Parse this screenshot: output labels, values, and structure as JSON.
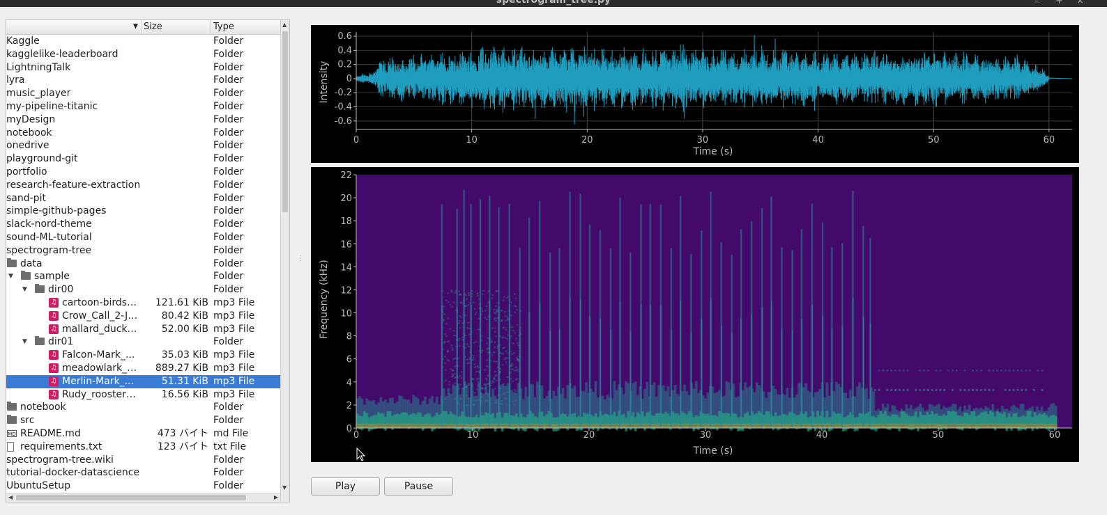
{
  "window": {
    "title": "spectrogram_tree.py"
  },
  "tree": {
    "columns": {
      "name": "",
      "size": "Size",
      "type": "Type"
    },
    "rows": [
      {
        "name": "Kaggle",
        "size": "",
        "type": "Folder",
        "depth": 0,
        "icon": "none"
      },
      {
        "name": "kagglelike-leaderboard",
        "size": "",
        "type": "Folder",
        "depth": 0,
        "icon": "none"
      },
      {
        "name": "LightningTalk",
        "size": "",
        "type": "Folder",
        "depth": 0,
        "icon": "none"
      },
      {
        "name": "lyra",
        "size": "",
        "type": "Folder",
        "depth": 0,
        "icon": "none"
      },
      {
        "name": "music_player",
        "size": "",
        "type": "Folder",
        "depth": 0,
        "icon": "none"
      },
      {
        "name": "my-pipeline-titanic",
        "size": "",
        "type": "Folder",
        "depth": 0,
        "icon": "none"
      },
      {
        "name": "myDesign",
        "size": "",
        "type": "Folder",
        "depth": 0,
        "icon": "none"
      },
      {
        "name": "notebook",
        "size": "",
        "type": "Folder",
        "depth": 0,
        "icon": "none"
      },
      {
        "name": "onedrive",
        "size": "",
        "type": "Folder",
        "depth": 0,
        "icon": "none"
      },
      {
        "name": "playground-git",
        "size": "",
        "type": "Folder",
        "depth": 0,
        "icon": "none"
      },
      {
        "name": "portfolio",
        "size": "",
        "type": "Folder",
        "depth": 0,
        "icon": "none"
      },
      {
        "name": "research-feature-extraction",
        "size": "",
        "type": "Folder",
        "depth": 0,
        "icon": "none"
      },
      {
        "name": "sand-pit",
        "size": "",
        "type": "Folder",
        "depth": 0,
        "icon": "none"
      },
      {
        "name": "simple-github-pages",
        "size": "",
        "type": "Folder",
        "depth": 0,
        "icon": "none"
      },
      {
        "name": "slack-nord-theme",
        "size": "",
        "type": "Folder",
        "depth": 0,
        "icon": "none"
      },
      {
        "name": "sound-ML-tutorial",
        "size": "",
        "type": "Folder",
        "depth": 0,
        "icon": "none"
      },
      {
        "name": "spectrogram-tree",
        "size": "",
        "type": "Folder",
        "depth": 0,
        "icon": "none"
      },
      {
        "name": "data",
        "size": "",
        "type": "Folder",
        "depth": 0,
        "icon": "folder"
      },
      {
        "name": "sample",
        "size": "",
        "type": "Folder",
        "depth": 1,
        "icon": "folder",
        "expanded": true
      },
      {
        "name": "dir00",
        "size": "",
        "type": "Folder",
        "depth": 2,
        "icon": "folder",
        "expanded": true
      },
      {
        "name": "cartoon-birds-...",
        "size": "121.61 KiB",
        "type": "mp3 File",
        "depth": 3,
        "icon": "music"
      },
      {
        "name": "Crow_Call_2-Ji...",
        "size": "80.42 KiB",
        "type": "mp3 File",
        "depth": 3,
        "icon": "music"
      },
      {
        "name": "mallard_duck_...",
        "size": "52.00 KiB",
        "type": "mp3 File",
        "depth": 3,
        "icon": "music"
      },
      {
        "name": "dir01",
        "size": "",
        "type": "Folder",
        "depth": 2,
        "icon": "folder",
        "expanded": true
      },
      {
        "name": "Falcon-Mark_...",
        "size": "35.03 KiB",
        "type": "mp3 File",
        "depth": 3,
        "icon": "music"
      },
      {
        "name": "meadowlark_d...",
        "size": "889.27 KiB",
        "type": "mp3 File",
        "depth": 3,
        "icon": "music"
      },
      {
        "name": "Merlin-Mark_...",
        "size": "51.31 KiB",
        "type": "mp3 File",
        "depth": 3,
        "icon": "music",
        "selected": true
      },
      {
        "name": "Rudy_rooster_...",
        "size": "16.56 KiB",
        "type": "mp3 File",
        "depth": 3,
        "icon": "music"
      },
      {
        "name": "notebook",
        "size": "",
        "type": "Folder",
        "depth": 0,
        "icon": "folder"
      },
      {
        "name": "src",
        "size": "",
        "type": "Folder",
        "depth": 0,
        "icon": "folder"
      },
      {
        "name": "README.md",
        "size": "473 バイト",
        "type": "md File",
        "depth": 0,
        "icon": "md"
      },
      {
        "name": "requirements.txt",
        "size": "123 バイト",
        "type": "txt File",
        "depth": 0,
        "icon": "txt"
      },
      {
        "name": "spectrogram-tree.wiki",
        "size": "",
        "type": "Folder",
        "depth": 0,
        "icon": "none"
      },
      {
        "name": "tutorial-docker-datascience",
        "size": "",
        "type": "Folder",
        "depth": 0,
        "icon": "none"
      },
      {
        "name": "UbuntuSetup",
        "size": "",
        "type": "Folder",
        "depth": 0,
        "icon": "none"
      }
    ]
  },
  "waveform_chart": {
    "chart_data": {
      "type": "line",
      "xlabel": "Time (s)",
      "ylabel": "Intensity",
      "xlim": [
        0,
        62
      ],
      "ylim": [
        -0.72,
        0.66
      ],
      "xticks": [
        0,
        10,
        20,
        30,
        40,
        50,
        60
      ],
      "yticks": [
        0.6,
        0.4,
        0.2,
        0,
        -0.2,
        -0.4,
        -0.6
      ],
      "grid": true,
      "line_color": "#1f9dbf",
      "duration_s": 60,
      "envelope": {
        "t": [
          0,
          1.5,
          2,
          5,
          8,
          10,
          12,
          15,
          18,
          20,
          22,
          25,
          28,
          30,
          32,
          35,
          38,
          40,
          42,
          45,
          48,
          50,
          52,
          55,
          58,
          59.5,
          60
        ],
        "amp": [
          0.05,
          0.1,
          0.3,
          0.35,
          0.4,
          0.42,
          0.5,
          0.45,
          0.45,
          0.5,
          0.45,
          0.45,
          0.5,
          0.45,
          0.42,
          0.45,
          0.42,
          0.4,
          0.4,
          0.4,
          0.4,
          0.42,
          0.38,
          0.35,
          0.3,
          0.15,
          0.02
        ]
      }
    }
  },
  "spectrogram_chart": {
    "chart_data": {
      "type": "heatmap",
      "xlabel": "Time (s)",
      "ylabel": "Frequency (kHz)",
      "xlim": [
        0,
        61.5
      ],
      "ylim": [
        0,
        22
      ],
      "xticks": [
        0,
        10,
        20,
        30,
        40,
        50,
        60
      ],
      "yticks": [
        0,
        2,
        4,
        6,
        8,
        10,
        12,
        14,
        16,
        18,
        20,
        22
      ],
      "colormap": "viridis",
      "background_color": "#440a6b",
      "event_times_s": [
        7.3,
        8.6,
        9.2,
        9.8,
        10.6,
        11.4,
        12.2,
        13.1,
        14.0,
        14.8,
        15.7,
        16.6,
        17.4,
        18.3,
        19.2,
        20.0,
        20.9,
        21.8,
        22.6,
        23.5,
        24.4,
        25.2,
        26.1,
        27.0,
        27.8,
        28.7,
        29.6,
        30.4,
        31.3,
        32.2,
        33.0,
        33.9,
        34.8,
        35.6,
        36.5,
        37.4,
        38.2,
        39.1,
        40.0,
        40.8,
        41.7,
        42.6,
        43.5,
        44.1
      ],
      "harmonic_bands_khz": [
        3.3,
        5.0
      ]
    }
  },
  "controls": {
    "play_label": "Play",
    "pause_label": "Pause"
  }
}
